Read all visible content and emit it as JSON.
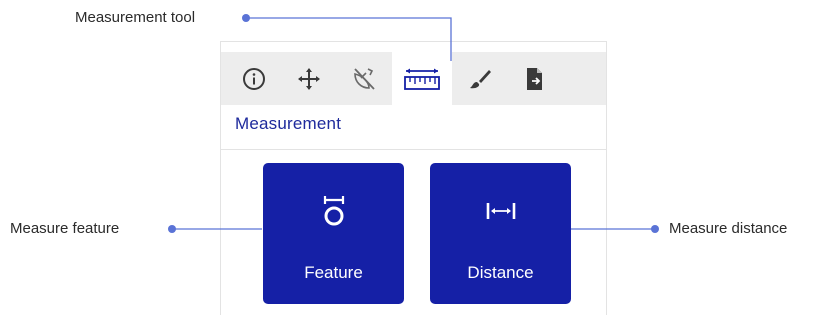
{
  "callouts": {
    "measurement_tool": "Measurement tool",
    "measure_feature": "Measure feature",
    "measure_distance": "Measure distance"
  },
  "toolbar": {
    "tools": [
      {
        "name": "info-icon",
        "active": false
      },
      {
        "name": "move-icon",
        "active": false
      },
      {
        "name": "hide-icon",
        "active": false
      },
      {
        "name": "ruler-icon",
        "active": true
      },
      {
        "name": "brush-icon",
        "active": false
      },
      {
        "name": "export-icon",
        "active": false
      }
    ]
  },
  "panel": {
    "title": "Measurement",
    "buttons": {
      "feature": {
        "label": "Feature",
        "icon": "measure-feature-icon"
      },
      "distance": {
        "label": "Distance",
        "icon": "measure-distance-icon"
      }
    }
  },
  "colors": {
    "accent": "#1520a6",
    "title": "#1e2a9c",
    "callout_line": "#5a73d6",
    "toolbar_bg": "#ededed"
  }
}
